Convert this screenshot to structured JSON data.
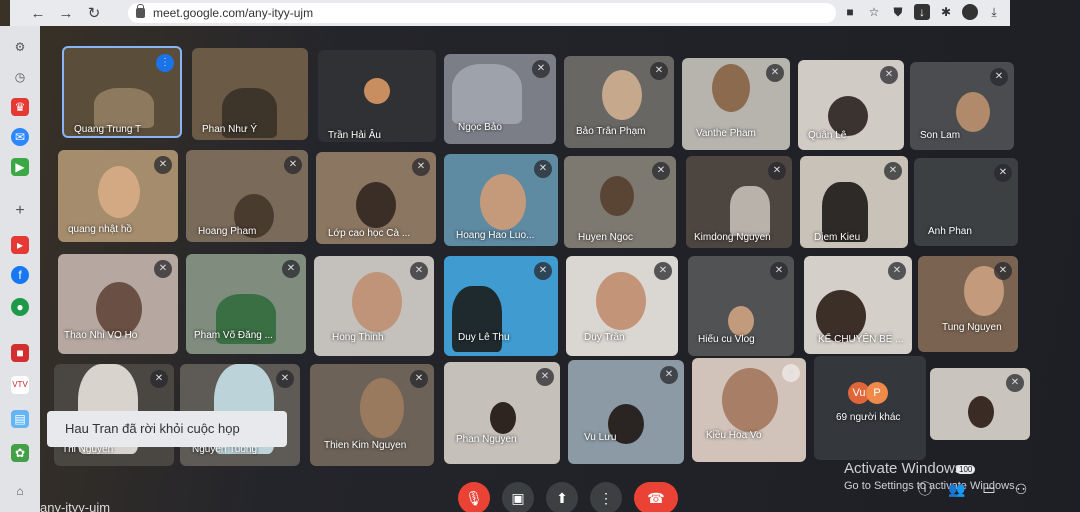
{
  "browser": {
    "url": "meet.google.com/any-ityy-ujm",
    "back_icon": "←",
    "forward_icon": "→",
    "reload_icon": "↻"
  },
  "tiles": [
    {
      "name": "Quang Trung T"
    },
    {
      "name": "Phan Như Ý"
    },
    {
      "name": "Trần Hải Âu"
    },
    {
      "name": "Ngọc Bảo"
    },
    {
      "name": "Bảo Trân Phạm"
    },
    {
      "name": "Vanthe Pham"
    },
    {
      "name": "Quân Lê"
    },
    {
      "name": "Son Lam"
    },
    {
      "name": "quang nhật hồ"
    },
    {
      "name": "Hoang Pham"
    },
    {
      "name": "Lớp cao học Cà ..."
    },
    {
      "name": "Hoang Hao Luo..."
    },
    {
      "name": "Huyen Ngoc"
    },
    {
      "name": "Kimdong Nguyen"
    },
    {
      "name": "Diem Kieu"
    },
    {
      "name": "Anh Phan"
    },
    {
      "name": "Thao Nhi VO Ho"
    },
    {
      "name": "Pham Võ Đăng ..."
    },
    {
      "name": "Hong Thinh"
    },
    {
      "name": "Duy Lê Thu"
    },
    {
      "name": "Duy Trần"
    },
    {
      "name": "Hiếu cu Vlog"
    },
    {
      "name": "KỂ CHUYỆN BÉ ..."
    },
    {
      "name": "Tung Nguyen"
    },
    {
      "name": "Thi Nguyen"
    },
    {
      "name": "Nguyen Tuong"
    },
    {
      "name": "Thien Kim Nguyen"
    },
    {
      "name": "Phan Nguyen"
    },
    {
      "name": "Vu Lưu"
    },
    {
      "name": "Kiều Hoa Vo"
    },
    {
      "name": ""
    }
  ],
  "others": {
    "label": "69 người khác",
    "avatars": [
      "Vu",
      "P"
    ]
  },
  "toast": "Hau Tran đã rời khỏi cuộc họp",
  "activate": {
    "title": "Activate Windows",
    "subtitle": "Go to Settings to activate Windows."
  },
  "meeting_code": "any-ityy-ujm",
  "people_count": "100",
  "controls": {
    "mic": "🎙",
    "camera": "▣",
    "present": "⬆",
    "more": "⋮",
    "end": "☎"
  }
}
